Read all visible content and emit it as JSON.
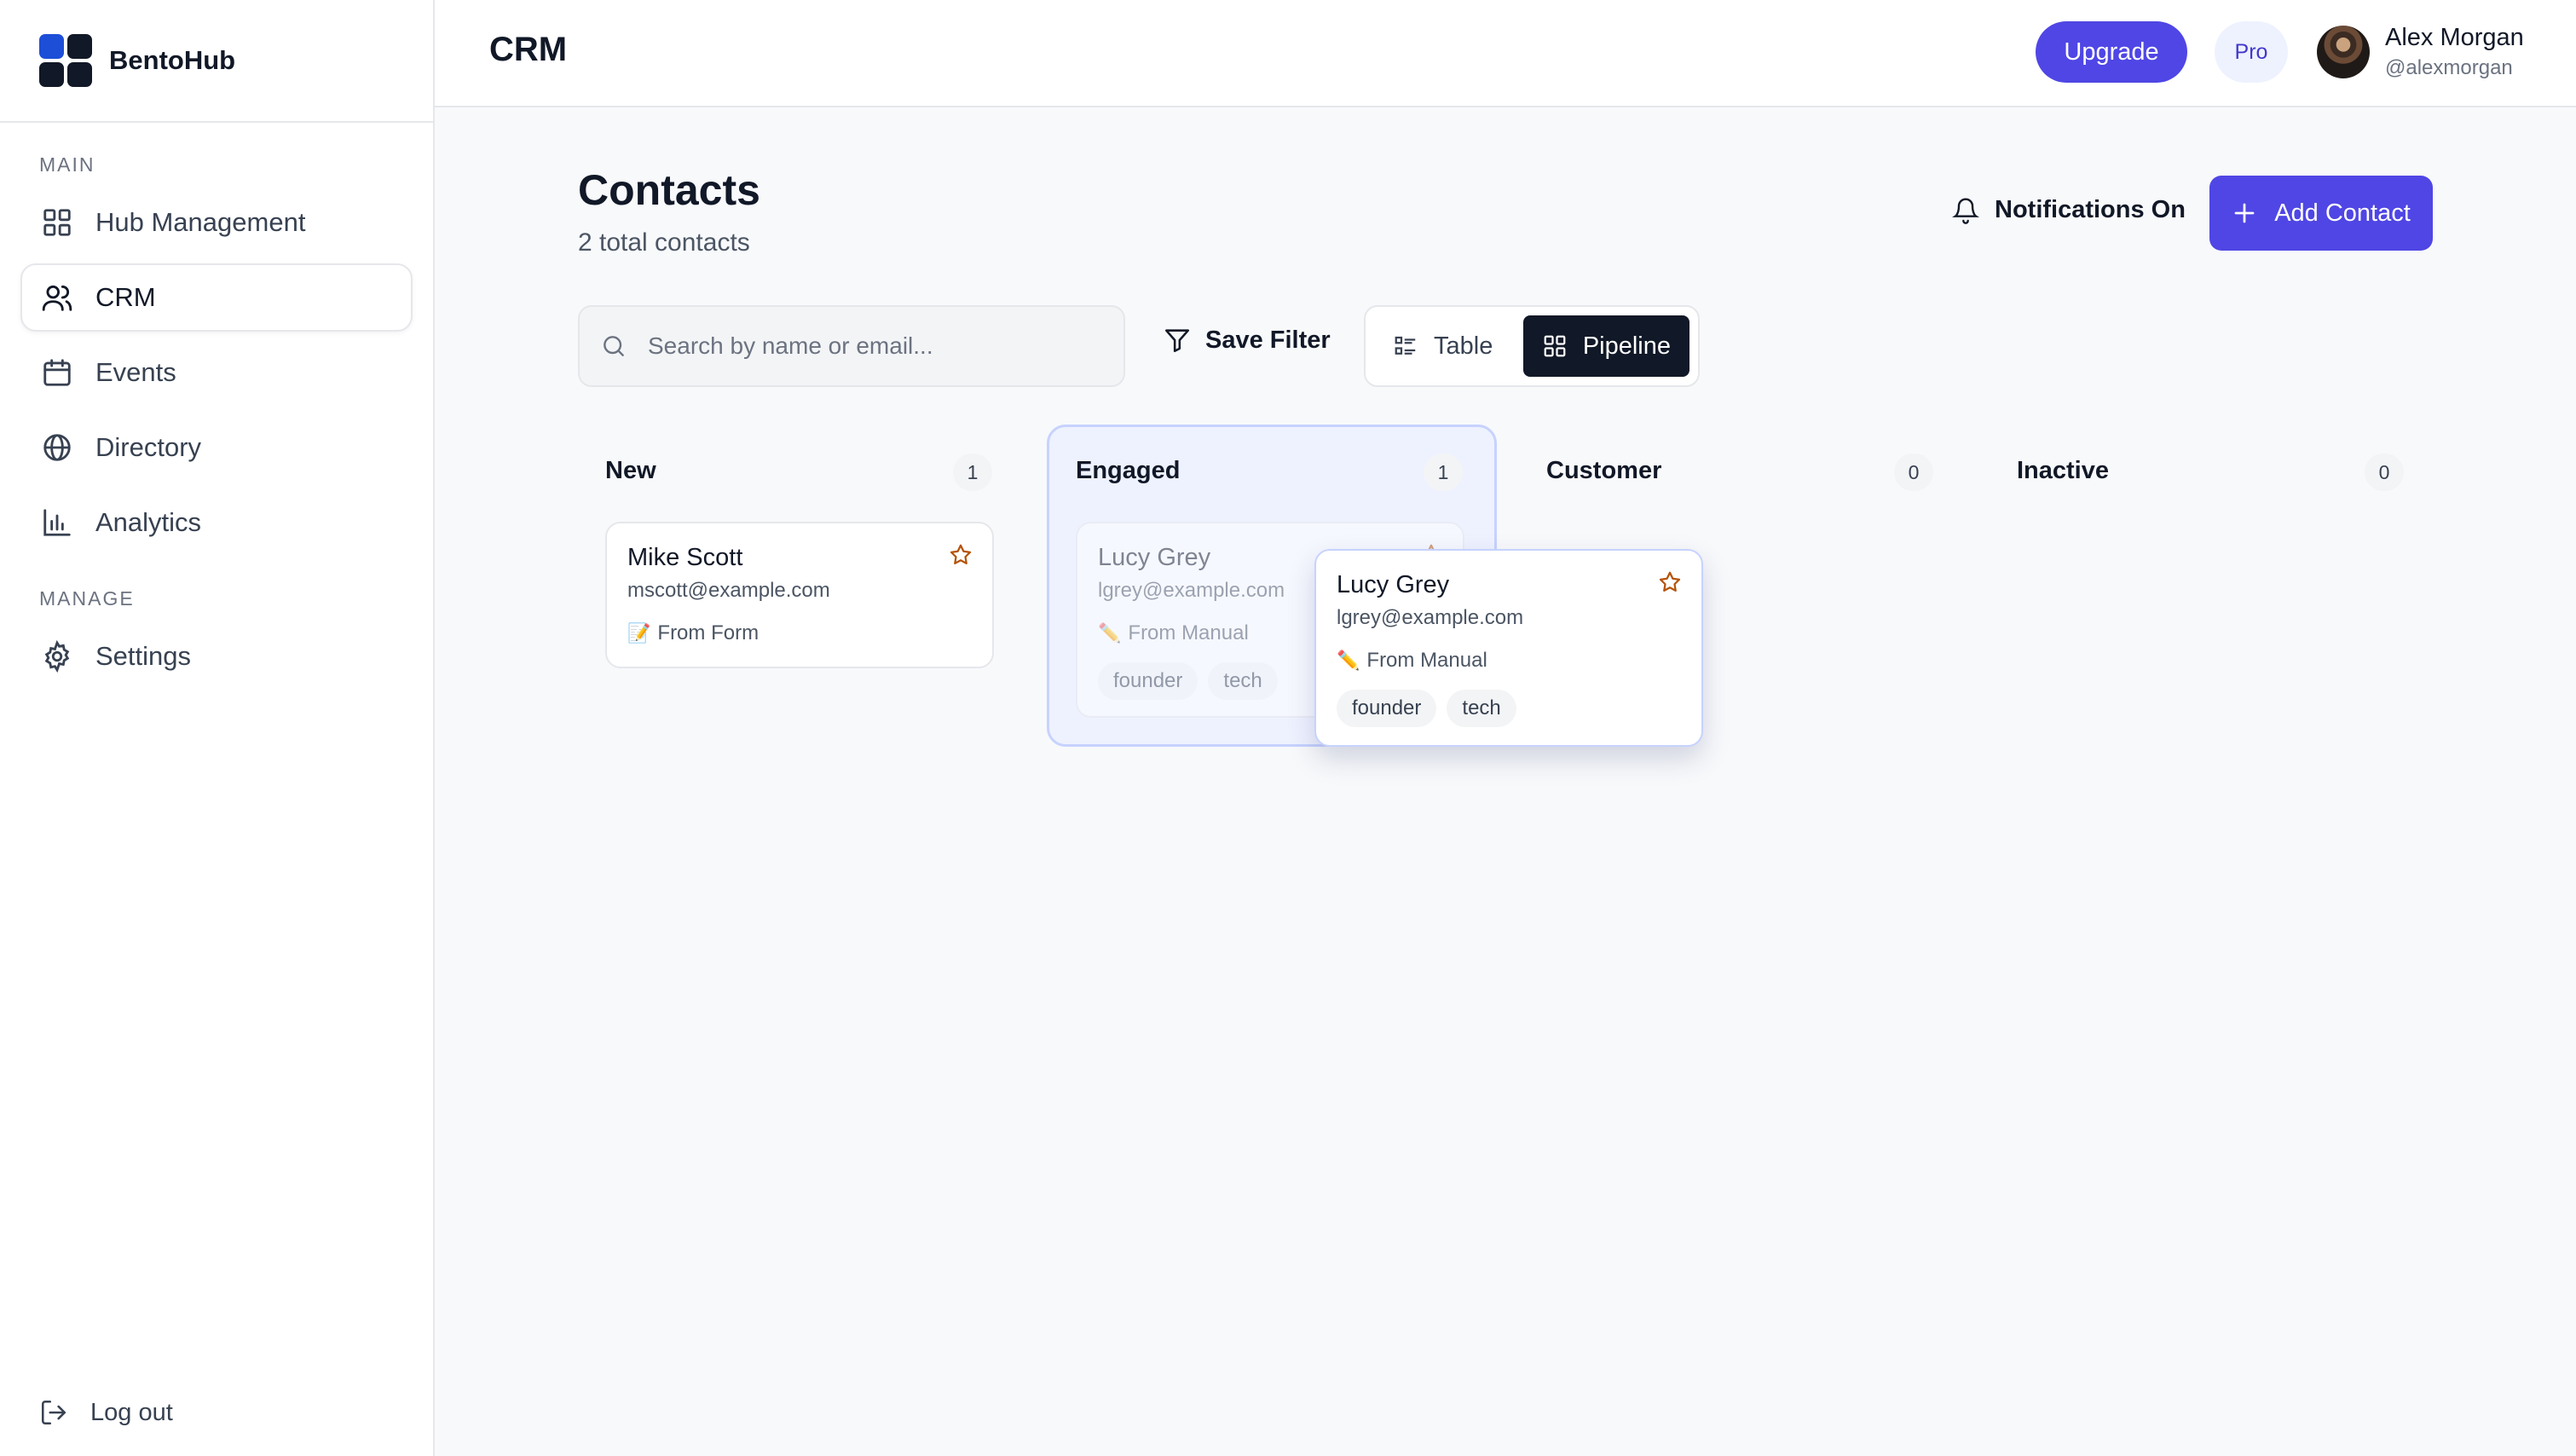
{
  "brand": {
    "name": "BentoHub",
    "logo_colors": [
      "#1d4ed8",
      "#111827",
      "#111827",
      "#111827"
    ]
  },
  "sidebar": {
    "sections": [
      {
        "label": "MAIN",
        "items": [
          {
            "label": "Hub Management",
            "icon": "grid-icon"
          },
          {
            "label": "CRM",
            "icon": "users-icon",
            "active": true
          },
          {
            "label": "Events",
            "icon": "calendar-icon"
          },
          {
            "label": "Directory",
            "icon": "globe-icon"
          },
          {
            "label": "Analytics",
            "icon": "bar-chart-icon"
          }
        ]
      },
      {
        "label": "MANAGE",
        "items": [
          {
            "label": "Settings",
            "icon": "gear-icon"
          }
        ]
      }
    ],
    "logout_label": "Log out"
  },
  "topbar": {
    "title": "CRM",
    "upgrade_label": "Upgrade",
    "plan_badge": "Pro",
    "user": {
      "name": "Alex Morgan",
      "handle": "@alexmorgan"
    }
  },
  "contacts": {
    "title": "Contacts",
    "subtitle": "2 total contacts",
    "notifications_label": "Notifications On",
    "add_label": "Add Contact",
    "search_placeholder": "Search by name or email...",
    "search_value": "",
    "save_filter_label": "Save Filter",
    "views": {
      "table_label": "Table",
      "pipeline_label": "Pipeline",
      "active": "Pipeline"
    }
  },
  "pipeline": {
    "columns": [
      {
        "label": "New",
        "count": "1"
      },
      {
        "label": "Engaged",
        "count": "1"
      },
      {
        "label": "Customer",
        "count": "0"
      },
      {
        "label": "Inactive",
        "count": "0"
      }
    ],
    "cards": {
      "mike": {
        "name": "Mike Scott",
        "email": "mscott@example.com",
        "source": "From Form",
        "source_icon": "📝"
      },
      "lucy": {
        "name": "Lucy Grey",
        "email": "lgrey@example.com",
        "source": "From Manual",
        "source_icon": "✏️",
        "tags": [
          "founder",
          "tech"
        ]
      }
    }
  },
  "colors": {
    "accent": "#4f46e5",
    "dark": "#111827",
    "star": "#b45309",
    "engaged_bg": "#eef2ff"
  }
}
